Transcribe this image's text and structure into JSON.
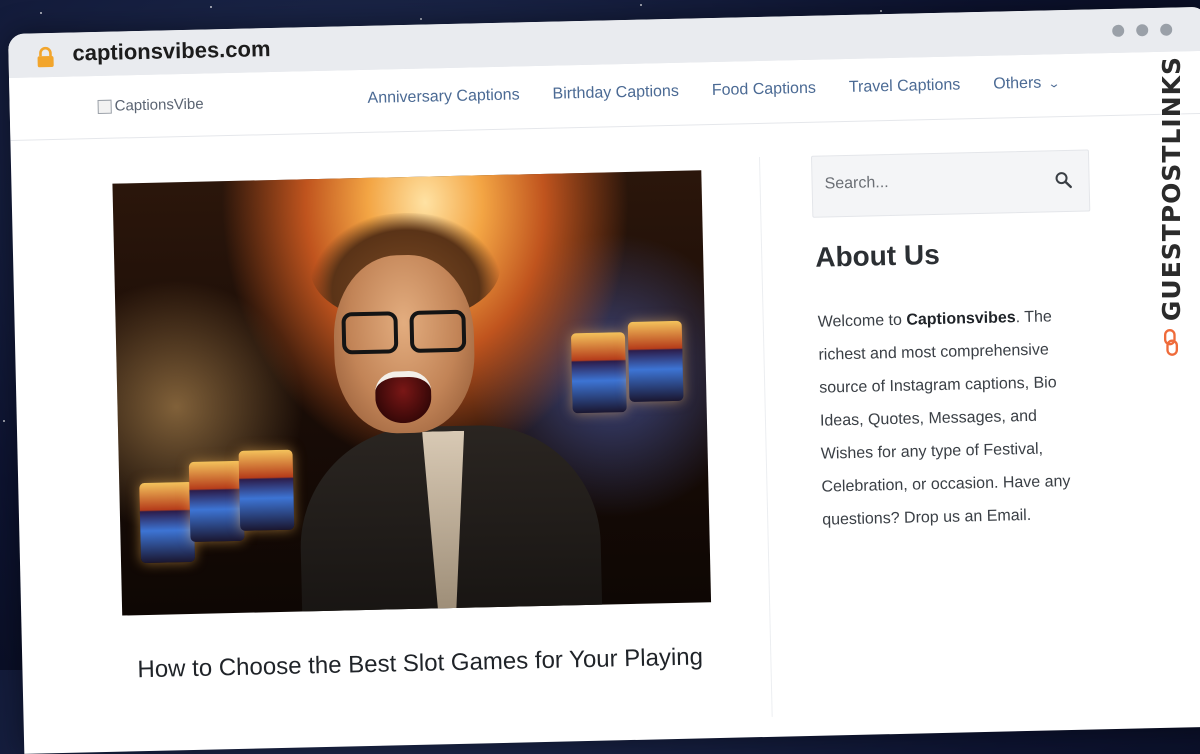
{
  "browser": {
    "url": "captionsvibes.com"
  },
  "site": {
    "logo_alt": "CaptionsVibe",
    "nav": [
      "Anniversary Captions",
      "Birthday Captions",
      "Food Captions",
      "Travel Captions",
      "Others"
    ]
  },
  "post": {
    "title": "How to Choose the Best Slot Games for Your Playing"
  },
  "sidebar": {
    "search_placeholder": "Search...",
    "about_title": "About Us",
    "about_pre": "Welcome to ",
    "about_brand": "Captionsvibes",
    "about_post": ". The richest and most comprehensive source of Instagram captions, Bio Ideas, Quotes, Messages, and Wishes for any type of Festival, Celebration, or occasion. Have any questions? Drop us an Email."
  },
  "watermark": {
    "text": "GUESTPOSTLINKS"
  },
  "icons": {
    "lock": "lock-icon",
    "chevron": "chevron-down-icon",
    "search": "search-icon",
    "watermark_logo": "link-chain-icon"
  },
  "colors": {
    "nav_link": "#4b6a94",
    "lock": "#f2a52c",
    "watermark_accent": "#ef6b3a"
  }
}
